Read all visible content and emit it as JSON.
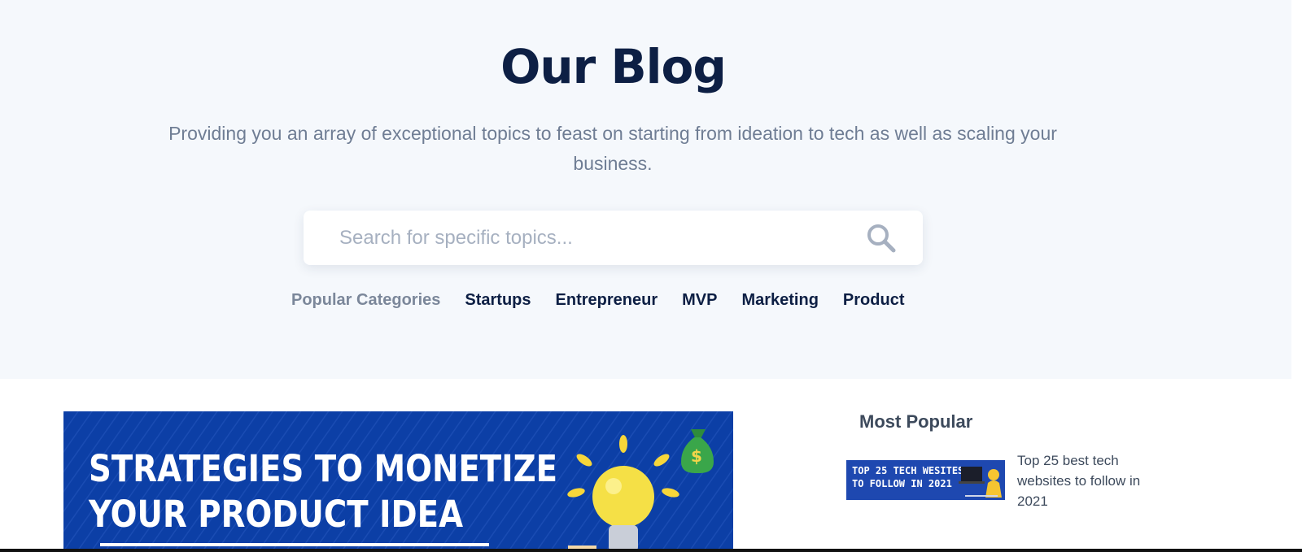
{
  "hero": {
    "title": "Our Blog",
    "subtitle": "Providing you an array of exceptional topics to feast on starting from ideation to tech as well as scaling your business."
  },
  "search": {
    "placeholder": "Search for specific topics...",
    "icon": "search-icon"
  },
  "categories": {
    "label": "Popular Categories",
    "items": [
      "Startups",
      "Entrepreneur",
      "MVP",
      "Marketing",
      "Product"
    ]
  },
  "featured": {
    "line1": "STRATEGIES TO MONETIZE",
    "line2": "YOUR PRODUCT IDEA"
  },
  "sidebar": {
    "title": "Most Popular",
    "items": [
      {
        "thumb_line1": "TOP 25 TECH WESITES",
        "thumb_line2": "TO FOLLOW IN 2021",
        "title": "Top 25 best tech websites to follow in 2021"
      }
    ]
  },
  "colors": {
    "navy": "#0d1f44",
    "muted": "#6f7d94",
    "hero_bg": "#f5f8fc",
    "banner_blue": "#0c3fa6"
  }
}
